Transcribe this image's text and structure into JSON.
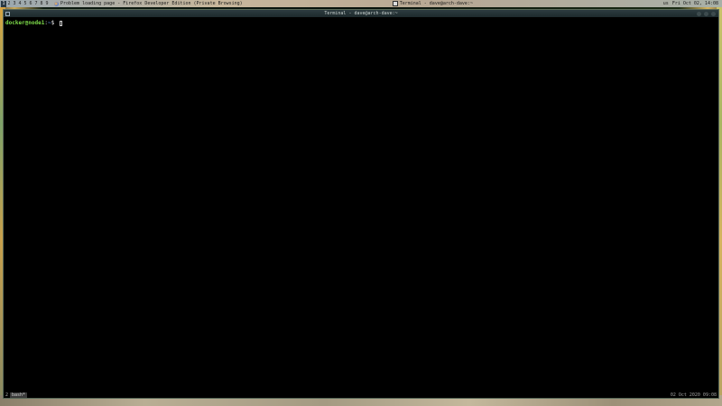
{
  "panel": {
    "workspaces": [
      "1",
      "2",
      "3",
      "4",
      "5",
      "6",
      "7",
      "8",
      "9"
    ],
    "active_workspace": "1",
    "tasks": [
      {
        "label": "Problem loading page - Firefox Developer Edition (Private Browsing)",
        "icon": "firefox-icon"
      },
      {
        "label": "Terminal - dave@arch-dave:~",
        "icon": "terminal-icon"
      }
    ],
    "tray": {
      "layout": "us",
      "clock": "Fri Oct 02, 14:08"
    }
  },
  "window": {
    "title": "Terminal - dave@arch-dave:~"
  },
  "terminal": {
    "prompt_user": "docker@node1",
    "prompt_sep": ":",
    "prompt_path": "~",
    "prompt_sym": "$ "
  },
  "tmux": {
    "session": "2",
    "window": "bash*",
    "datetime": "02 Oct 2020 09:08"
  },
  "colors": {
    "prompt_user": "#7edc4a",
    "prompt_path": "#5c8fe0",
    "terminal_bg": "#000000"
  }
}
